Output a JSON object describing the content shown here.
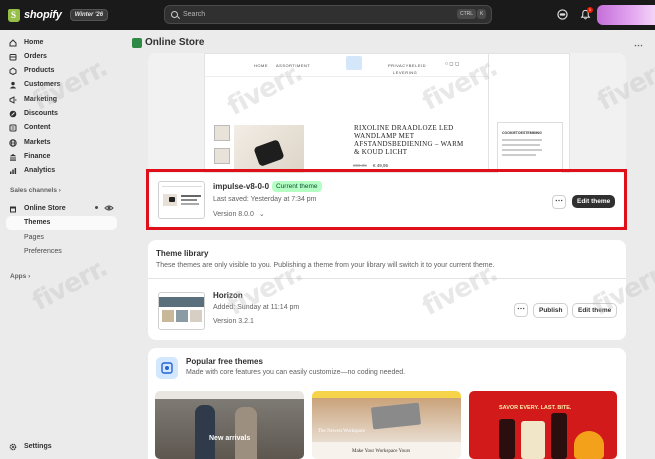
{
  "topbar": {
    "brand": "shopify",
    "edition_badge": "Winter '26",
    "search_placeholder": "Search",
    "shortcut_ctrl": "CTRL",
    "shortcut_key": "K",
    "notification_count": "1"
  },
  "sidebar": {
    "items": [
      {
        "label": "Home",
        "icon": "home-icon"
      },
      {
        "label": "Orders",
        "icon": "orders-icon"
      },
      {
        "label": "Products",
        "icon": "products-icon"
      },
      {
        "label": "Customers",
        "icon": "customers-icon"
      },
      {
        "label": "Marketing",
        "icon": "marketing-icon"
      },
      {
        "label": "Discounts",
        "icon": "discounts-icon"
      },
      {
        "label": "Content",
        "icon": "content-icon"
      },
      {
        "label": "Markets",
        "icon": "markets-icon"
      },
      {
        "label": "Finance",
        "icon": "finance-icon"
      },
      {
        "label": "Analytics",
        "icon": "analytics-icon"
      }
    ],
    "sales_channels_label": "Sales channels",
    "online_store": "Online Store",
    "sub_items": [
      "Themes",
      "Pages",
      "Preferences"
    ],
    "apps_label": "Apps",
    "settings_label": "Settings"
  },
  "page": {
    "title": "Online Store"
  },
  "preview": {
    "nav_home": "HOME",
    "nav_assortment": "ASSORTIMENT",
    "nav_privacy": "PRIVACYBELEID",
    "nav_delivery": "LEVERING",
    "product_title": "RIXOLINE DRAADLOZE LED WANDLAMP MET AFSTANDSBEDIENING – WARM & KOUD LICHT",
    "old_price": "€99,95",
    "price": "€ 49,95",
    "cookie_title": "COOKIETOESTEMMING"
  },
  "current_theme": {
    "name": "impulse-v8-0-0",
    "badge": "Current theme",
    "last_saved": "Last saved: Yesterday at 7:34 pm",
    "version": "Version 8.0.0",
    "edit_label": "Edit theme"
  },
  "library": {
    "title": "Theme library",
    "description": "These themes are only visible to you. Publishing a theme from your library will switch it to your current theme.",
    "themes": [
      {
        "name": "Horizon",
        "added": "Added: Sunday at 11:14 pm",
        "version": "Version 3.2.1",
        "publish_label": "Publish",
        "edit_label": "Edit theme"
      }
    ]
  },
  "free_themes": {
    "title": "Popular free themes",
    "description": "Made with core features you can easily customize—no coding needed.",
    "cards": [
      {
        "headline": "New arrivals"
      },
      {
        "headline": "Make Your Workspace Yours",
        "subhead": "The Newest Workspace"
      },
      {
        "headline": "SAVOR EVERY. LAST. BITE."
      }
    ]
  },
  "watermark": "fiverr."
}
